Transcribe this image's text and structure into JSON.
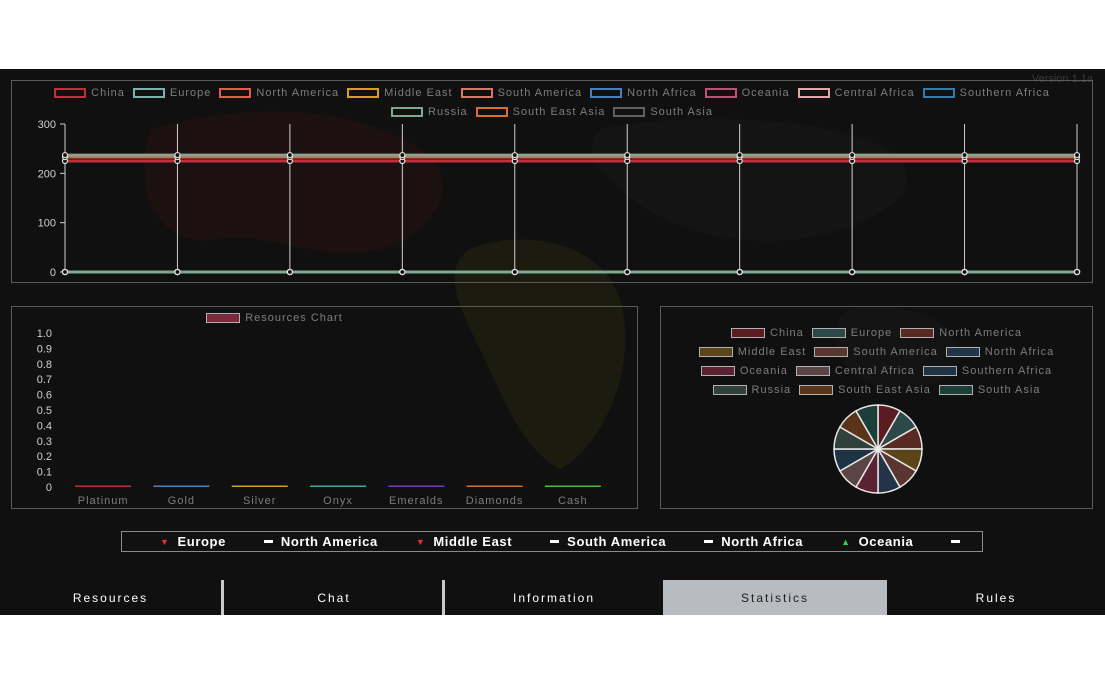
{
  "version": "Version 1.1a",
  "line_chart": {
    "legend": [
      {
        "name": "China",
        "color": "#c0303c"
      },
      {
        "name": "Europe",
        "color": "#7fb0b0"
      },
      {
        "name": "North America",
        "color": "#e0604a"
      },
      {
        "name": "Middle East",
        "color": "#d4a020"
      },
      {
        "name": "South America",
        "color": "#d07a68"
      },
      {
        "name": "North Africa",
        "color": "#4a7fb8"
      },
      {
        "name": "Oceania",
        "color": "#c0507a"
      },
      {
        "name": "Central Africa",
        "color": "#e0a8a8"
      },
      {
        "name": "Southern Africa",
        "color": "#3a7aa8"
      },
      {
        "name": "Russia",
        "color": "#7fa890"
      },
      {
        "name": "South East Asia",
        "color": "#d87030"
      },
      {
        "name": "South Asia",
        "color": "#606060"
      }
    ]
  },
  "bar_chart": {
    "legend_label": "Resources Chart",
    "legend_color": "#7a2a3a"
  },
  "pie_chart": {
    "legend": [
      {
        "name": "China",
        "color": "#5a1c22"
      },
      {
        "name": "Europe",
        "color": "#2d4848"
      },
      {
        "name": "North America",
        "color": "#5a2a22"
      },
      {
        "name": "Middle East",
        "color": "#5a4418"
      },
      {
        "name": "South America",
        "color": "#5a3630"
      },
      {
        "name": "North Africa",
        "color": "#243448"
      },
      {
        "name": "Oceania",
        "color": "#5a2232"
      },
      {
        "name": "Central Africa",
        "color": "#5a4444"
      },
      {
        "name": "Southern Africa",
        "color": "#1e3444"
      },
      {
        "name": "Russia",
        "color": "#30403a"
      },
      {
        "name": "South East Asia",
        "color": "#5a3418"
      },
      {
        "name": "South Asia",
        "color": "#1c4038"
      }
    ]
  },
  "chart_data": [
    {
      "type": "line",
      "x": [
        0,
        1,
        2,
        3,
        4,
        5,
        6,
        7,
        8,
        9
      ],
      "ylim": [
        0,
        300
      ],
      "yticks": [
        "0",
        "100",
        "200",
        "300"
      ],
      "grid": true,
      "legend_position": "top",
      "series": [
        {
          "name": "China",
          "values": [
            225,
            225,
            225,
            225,
            225,
            225,
            225,
            225,
            225,
            225
          ]
        },
        {
          "name": "Europe",
          "values": [
            0,
            0,
            0,
            0,
            0,
            0,
            0,
            0,
            0,
            0
          ]
        },
        {
          "name": "North America",
          "values": [
            233,
            233,
            233,
            233,
            233,
            233,
            233,
            233,
            233,
            233
          ]
        },
        {
          "name": "Middle East",
          "values": [
            0,
            0,
            0,
            0,
            0,
            0,
            0,
            0,
            0,
            0
          ]
        },
        {
          "name": "South America",
          "values": [
            0,
            0,
            0,
            0,
            0,
            0,
            0,
            0,
            0,
            0
          ]
        },
        {
          "name": "North Africa",
          "values": [
            0,
            0,
            0,
            0,
            0,
            0,
            0,
            0,
            0,
            0
          ]
        },
        {
          "name": "Oceania",
          "values": [
            0,
            0,
            0,
            0,
            0,
            0,
            0,
            0,
            0,
            0
          ]
        },
        {
          "name": "Central Africa",
          "values": [
            0,
            0,
            0,
            0,
            0,
            0,
            0,
            0,
            0,
            0
          ]
        },
        {
          "name": "Southern Africa",
          "values": [
            0,
            0,
            0,
            0,
            0,
            0,
            0,
            0,
            0,
            0
          ]
        },
        {
          "name": "Russia",
          "values": [
            237,
            237,
            237,
            237,
            237,
            237,
            237,
            237,
            237,
            237
          ]
        },
        {
          "name": "South East Asia",
          "values": [
            0,
            0,
            0,
            0,
            0,
            0,
            0,
            0,
            0,
            0
          ]
        },
        {
          "name": "South Asia",
          "values": [
            0,
            0,
            0,
            0,
            0,
            0,
            0,
            0,
            0,
            0
          ]
        }
      ]
    },
    {
      "type": "bar",
      "categories": [
        "Platinum",
        "Gold",
        "Silver",
        "Onyx",
        "Emeralds",
        "Diamonds",
        "Cash"
      ],
      "values": [
        0,
        0,
        0,
        0,
        0,
        0,
        0
      ],
      "bar_colors": [
        "#c0303c",
        "#4a7fb8",
        "#d4a020",
        "#3aa8a8",
        "#7a3ac0",
        "#d87030",
        "#40c040"
      ],
      "ylim": [
        0,
        1
      ],
      "yticks": [
        "0",
        "0.1",
        "0.2",
        "0.3",
        "0.4",
        "0.5",
        "0.6",
        "0.7",
        "0.8",
        "0.9",
        "1.0"
      ],
      "series": [
        {
          "name": "Resources Chart",
          "values": [
            0,
            0,
            0,
            0,
            0,
            0,
            0
          ]
        }
      ]
    },
    {
      "type": "pie",
      "labels": [
        "China",
        "Europe",
        "North America",
        "Middle East",
        "South America",
        "North Africa",
        "Oceania",
        "Central Africa",
        "Southern Africa",
        "Russia",
        "South East Asia",
        "South Asia"
      ],
      "values": [
        1,
        1,
        1,
        1,
        1,
        1,
        1,
        1,
        1,
        1,
        1,
        1
      ]
    }
  ],
  "ticker": [
    {
      "name": "Europe",
      "trend": "down"
    },
    {
      "name": "North America",
      "trend": "flat"
    },
    {
      "name": "Middle East",
      "trend": "down"
    },
    {
      "name": "South America",
      "trend": "flat"
    },
    {
      "name": "North Africa",
      "trend": "flat"
    },
    {
      "name": "Oceania",
      "trend": "up"
    },
    {
      "name": "",
      "trend": "flat"
    }
  ],
  "tabs": [
    {
      "label": "Resources",
      "active": false
    },
    {
      "label": "Chat",
      "active": false
    },
    {
      "label": "Information",
      "active": false
    },
    {
      "label": "Statistics",
      "active": true
    },
    {
      "label": "Rules",
      "active": false
    }
  ]
}
